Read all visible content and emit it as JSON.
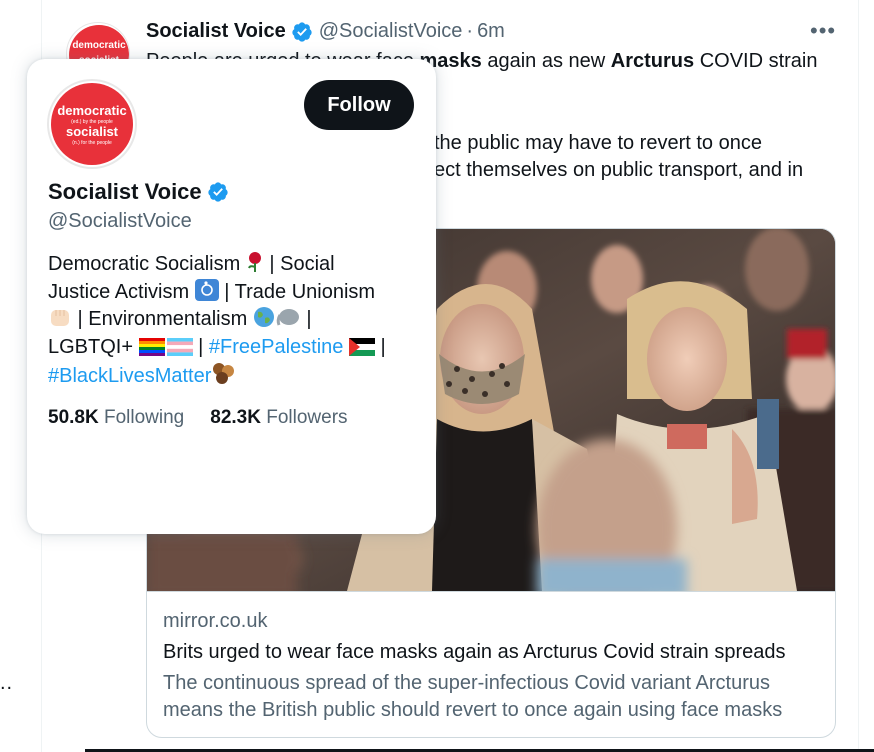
{
  "tweet": {
    "author_name": "Socialist Voice",
    "author_handle": "@SocialistVoice",
    "separator": "·",
    "time": "6m",
    "text_line1_a": "People are urged to wear face ",
    "text_line1_b": "masks",
    "text_line1_c": " again as new ",
    "text_line1_d": "Arcturus",
    "text_line1_e": " COVID strain",
    "text_line2": "the public may have to revert to once",
    "text_line3": "ect themselves on public transport, and in",
    "more_icon": "more-horizontal-icon"
  },
  "link_card": {
    "domain": "mirror.co.uk",
    "title": "Brits urged to wear face masks again as Arcturus Covid strain spreads",
    "desc_line1": "The continuous spread of the super-infectious Covid variant Arcturus",
    "desc_line2": "means the British public should revert to once again using face masks"
  },
  "hover_card": {
    "follow_label": "Follow",
    "name": "Socialist Voice",
    "handle": "@SocialistVoice",
    "bio": {
      "l1a": "Democratic Socialism ",
      "l1b": " | Social",
      "l2a": "Justice Activism ",
      "l2b": " | Trade Unionism",
      "l3a": " | Environmentalism ",
      "l3b": " |",
      "l4a": "LGBTQI+ ",
      "l4b": " | ",
      "l4c": "#FreePalestine",
      "l4d": " |",
      "l5a": "#BlackLivesMatter"
    },
    "following_count": "50.8K",
    "following_label": "Following",
    "followers_count": "82.3K",
    "followers_label": "Followers"
  },
  "avatar_logo": {
    "line1": "democratic",
    "line2": "(ed.) by the people",
    "line3": "socialist",
    "line4": "(n.) for the people"
  },
  "left_edge": "..",
  "colors": {
    "accent": "#1d9bf0",
    "text": "#0f1419",
    "muted": "#536471",
    "logo_red": "#e8313a"
  }
}
